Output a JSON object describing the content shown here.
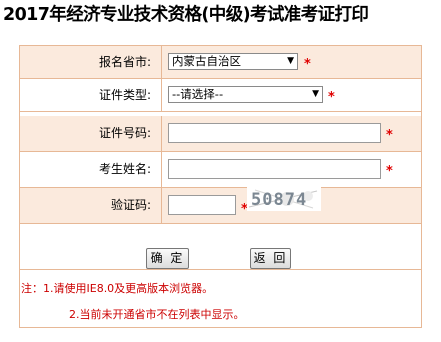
{
  "page": {
    "title": "2017年经济专业技术资格(中级)考试准考证打印"
  },
  "form": {
    "province": {
      "label": "报名省市:",
      "value": "内蒙古自治区"
    },
    "id_type": {
      "label": "证件类型:",
      "value": "--请选择--"
    },
    "id_number": {
      "label": "证件号码:",
      "value": ""
    },
    "name": {
      "label": "考生姓名:",
      "value": ""
    },
    "captcha": {
      "label": "验证码:",
      "value": "",
      "image_text": "50874"
    },
    "required_mark": "*"
  },
  "buttons": {
    "confirm": "确 定",
    "back": "返 回"
  },
  "notes": {
    "line1": "注：1.请使用IE8.0及更高版本浏览器。",
    "line2": "2.当前未开通省市不在列表中显示。"
  },
  "colors": {
    "border": "#e7b896",
    "shade": "#fbeadd",
    "required": "#e00000",
    "note_text": "#cc0000"
  },
  "icons": {
    "dropdown": "chevron-down-icon"
  }
}
